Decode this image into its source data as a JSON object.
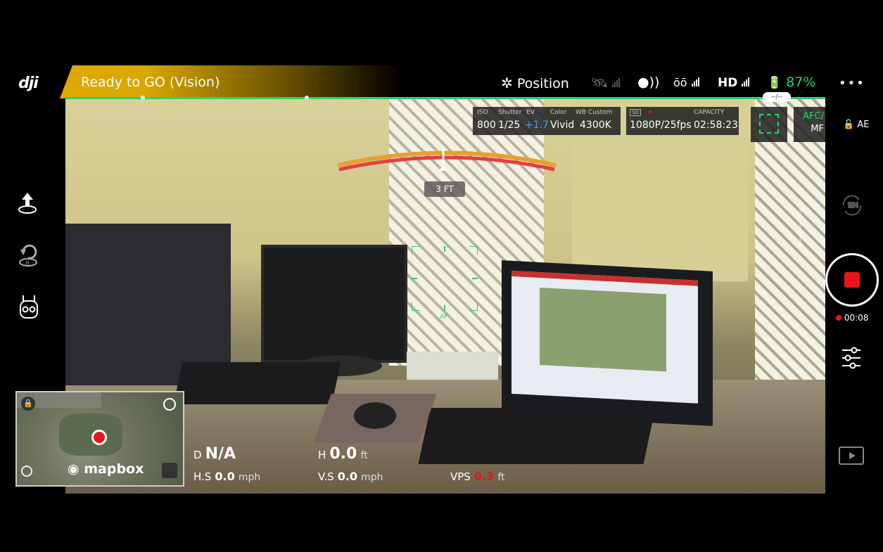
{
  "app": {
    "logo": "dji",
    "status": "Ready to GO (Vision)",
    "flight_mode": "Position",
    "hd_label": "HD",
    "battery_percent": "87%",
    "battery_sub": "--/--"
  },
  "camera": {
    "headers": {
      "iso": "ISO",
      "shutter": "Shutter",
      "ev": "EV",
      "color": "Color",
      "wb": "WB Custom"
    },
    "iso": "800",
    "shutter": "1/25",
    "ev": "+1.7",
    "color": "Vivid",
    "wb": "4300K",
    "sd_label": "SD",
    "capacity_label": "CAPACITY",
    "resolution": "1080P/25fps",
    "capacity": "02:58:23",
    "focus_line1": "AFC/",
    "focus_line2": "MF",
    "ae_label": "AE",
    "af_label": "AF",
    "obstacle_distance": "3 FT"
  },
  "record": {
    "time": "00:08"
  },
  "telemetry": {
    "d_label": "D",
    "d_value": "N/A",
    "h_label": "H",
    "h_value": "0.0",
    "h_unit": "ft",
    "hs_label": "H.S",
    "hs_value": "0.0",
    "hs_unit": "mph",
    "vs_label": "V.S",
    "vs_value": "0.0",
    "vs_unit": "mph",
    "vps_label": "VPS",
    "vps_value": "0.3",
    "vps_unit": "ft"
  },
  "map": {
    "brand": "mapbox"
  },
  "colors": {
    "accent_green": "#2ad46a",
    "status_yellow": "#e0a800",
    "record_red": "#e8141c",
    "ev_blue": "#3aa0ff",
    "vps_red": "#e8141c"
  },
  "icons": {
    "takeoff": "takeoff-icon",
    "return_home": "return-home-icon",
    "remote": "remote-controller-icon",
    "more": "more-icon",
    "settings": "camera-settings-icon",
    "playback": "playback-icon"
  }
}
